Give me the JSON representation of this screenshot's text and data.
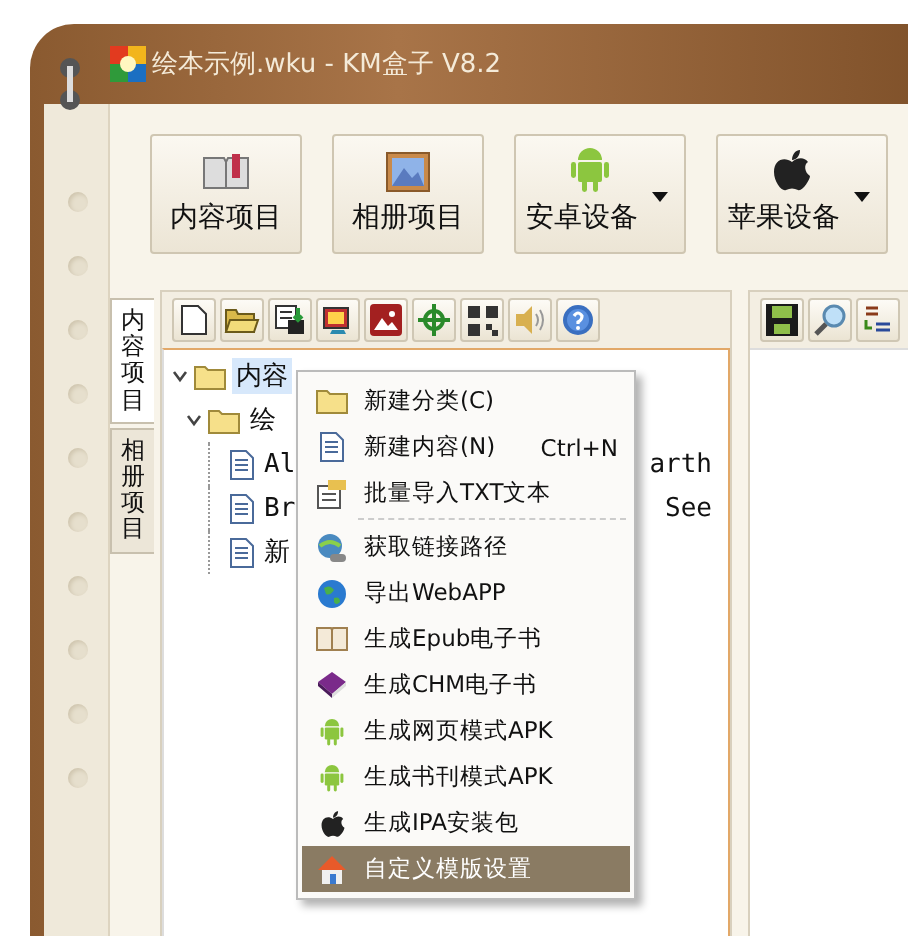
{
  "window": {
    "title": "绘本示例.wku - KM盒子 V8.2"
  },
  "big_buttons": [
    {
      "label": "内容项目",
      "kind": "book",
      "dropdown": false
    },
    {
      "label": "相册项目",
      "kind": "photo",
      "dropdown": false
    },
    {
      "label": "安卓设备",
      "kind": "android",
      "dropdown": true
    },
    {
      "label": "苹果设备",
      "kind": "apple",
      "dropdown": true
    }
  ],
  "side_tabs": [
    {
      "label": "内容项目",
      "selected": true
    },
    {
      "label": "相册项目",
      "selected": false
    }
  ],
  "tree": [
    {
      "label": "内容",
      "kind": "folder",
      "expanded": true,
      "selected": true,
      "children": [
        {
          "label": "绘",
          "kind": "folder",
          "expanded": true,
          "selected": false,
          "children": [
            {
              "label": "Al",
              "tail": "arth",
              "kind": "doc",
              "selected": false
            },
            {
              "label": "Br",
              "tail": "See",
              "kind": "doc",
              "selected": false
            },
            {
              "label": "新",
              "kind": "doc",
              "selected": false
            }
          ]
        }
      ]
    }
  ],
  "context_menu": [
    {
      "label": "新建分类(C)",
      "kind": "folder",
      "selected": false
    },
    {
      "label": "新建内容(N)",
      "shortcut": "Ctrl+N",
      "kind": "doc",
      "selected": false
    },
    {
      "label": "批量导入TXT文本",
      "kind": "import",
      "selected": false
    },
    {
      "label": "获取链接路径",
      "kind": "link",
      "separator_before": true,
      "selected": false
    },
    {
      "label": "导出WebAPP",
      "kind": "globe",
      "selected": false
    },
    {
      "label": "生成Epub电子书",
      "kind": "openbook",
      "selected": false
    },
    {
      "label": "生成CHM电子书",
      "kind": "purplebook",
      "selected": false
    },
    {
      "label": "生成网页模式APK",
      "kind": "android",
      "selected": false
    },
    {
      "label": "生成书刊模式APK",
      "kind": "android",
      "selected": false
    },
    {
      "label": "生成IPA安装包",
      "kind": "apple",
      "selected": false
    },
    {
      "label": "自定义模版设置",
      "kind": "home",
      "selected": true
    }
  ]
}
